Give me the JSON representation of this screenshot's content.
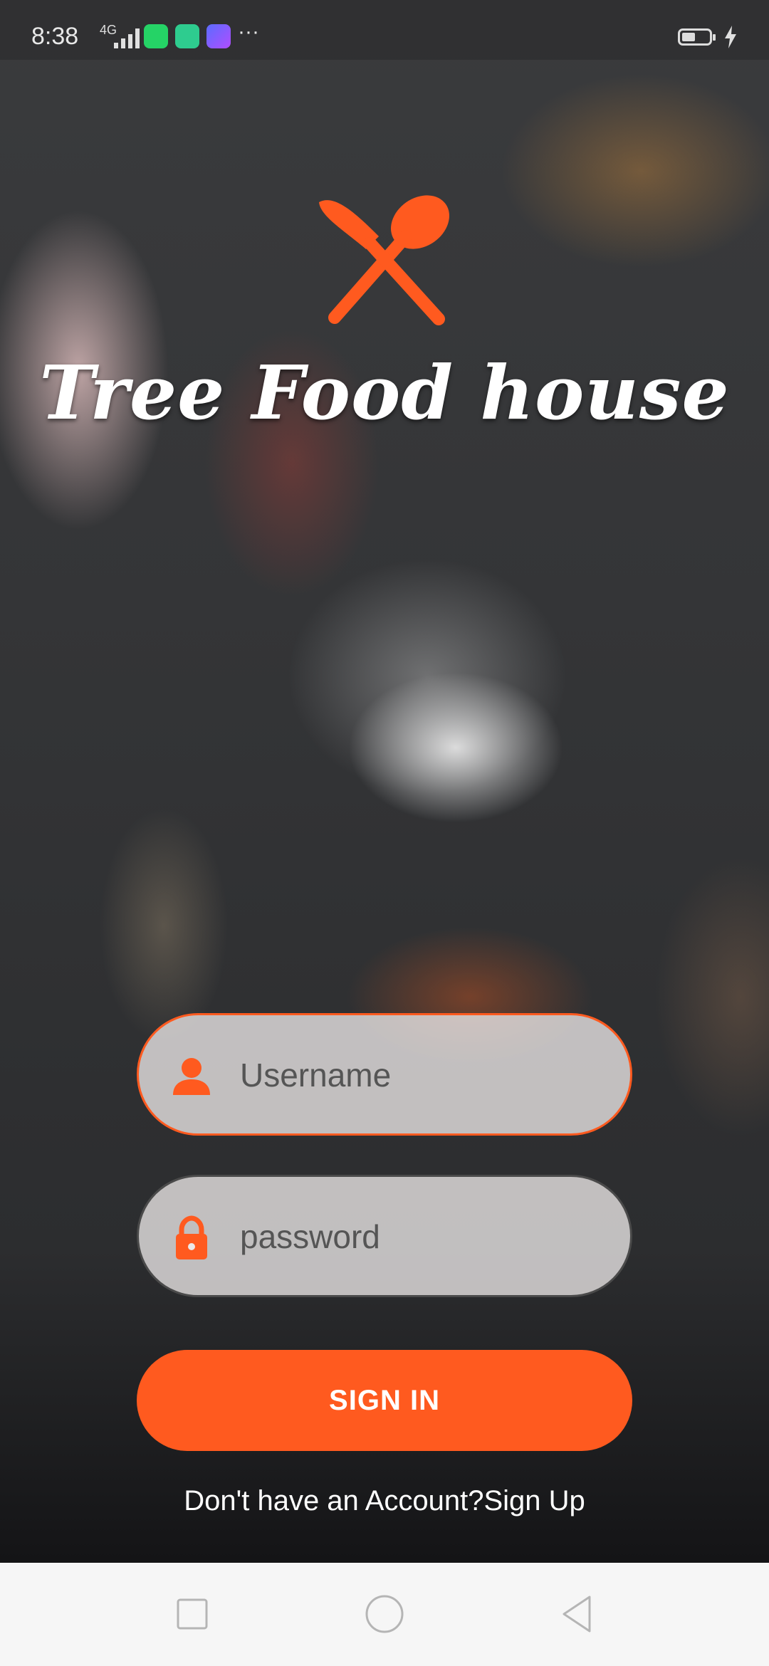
{
  "status_bar": {
    "time": "8:38",
    "network": "4G",
    "more": "···",
    "icons": [
      "whatsapp-icon",
      "notification-app-icon",
      "shortcut-app-icon",
      "battery-icon",
      "charging-icon"
    ]
  },
  "brand": {
    "title": "Tree Food house",
    "logo_icon": "crossed-knife-spoon-icon",
    "accent_color": "#ff5a1f"
  },
  "login_form": {
    "username": {
      "placeholder": "Username",
      "value": "",
      "icon": "person-icon"
    },
    "password": {
      "placeholder": "password",
      "value": "",
      "icon": "lock-icon"
    },
    "signin_label": "SIGN IN",
    "no_account_text": "Don't have an Account?",
    "signup_link": "Sign Up"
  },
  "nav_bar": {
    "buttons": [
      "recent-apps-button",
      "home-button",
      "back-button"
    ]
  }
}
